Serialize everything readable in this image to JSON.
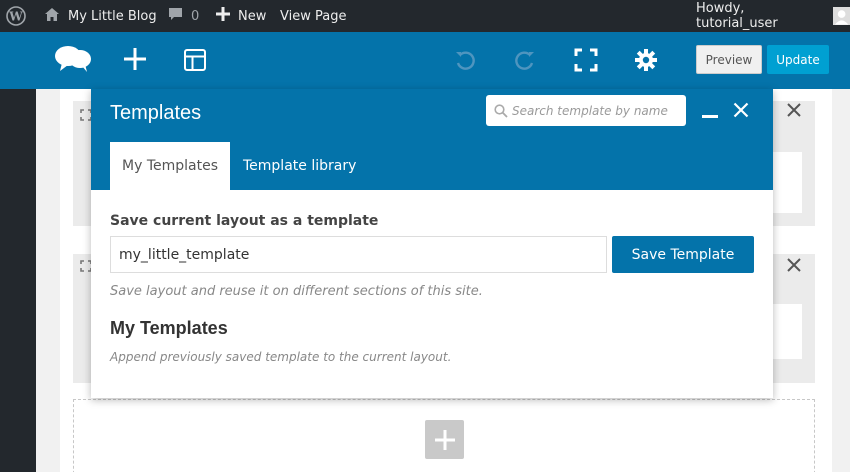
{
  "admin_bar": {
    "site_name": "My Little Blog",
    "comments_count": "0",
    "new_label": "New",
    "view_page_label": "View Page",
    "howdy": "Howdy, tutorial_user"
  },
  "toolbar": {
    "preview_label": "Preview",
    "update_label": "Update",
    "colors": {
      "bar": "#0473aa",
      "update_btn": "#00a0d2"
    }
  },
  "modal": {
    "title": "Templates",
    "search_placeholder": "Search template by name",
    "tabs": [
      {
        "label": "My Templates",
        "active": true
      },
      {
        "label": "Template library",
        "active": false
      }
    ],
    "save_section_label": "Save current layout as a template",
    "template_name_value": "my_little_template",
    "save_button_label": "Save Template",
    "save_hint": "Save layout and reuse it on different sections of this site.",
    "my_templates_heading": "My Templates",
    "my_templates_hint": "Append previously saved template to the current layout."
  }
}
